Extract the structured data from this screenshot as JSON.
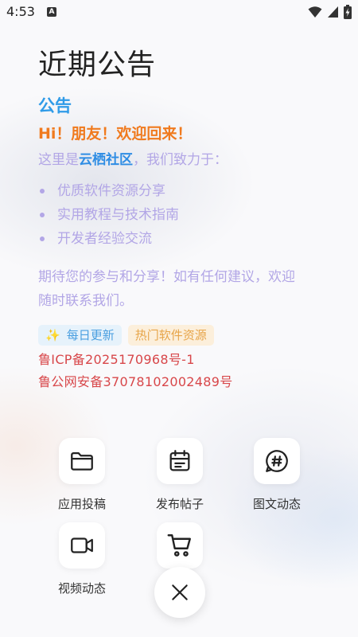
{
  "status_bar": {
    "time": "4:53",
    "notification_icon": "A"
  },
  "title": "近期公告",
  "notice": {
    "heading": "公告",
    "greeting": "Hi！朋友！欢迎回来！",
    "intro_prefix": "这里是",
    "community_name": "云栖社区",
    "intro_suffix": "，我们致力于：",
    "features": [
      "优质软件资源分享",
      "实用教程与技术指南",
      "开发者经验交流"
    ],
    "closing": "期待您的参与和分享！如有任何建议，欢迎随时联系我们。",
    "tags": {
      "daily": "每日更新",
      "hot": "热门软件资源"
    },
    "icp": "鲁ICP备2025170968号-1",
    "police_record": "鲁公网安备37078102002489号"
  },
  "actions": {
    "app_submit": "应用投稿",
    "publish_post": "发布帖子",
    "image_text": "图文动态",
    "video": "视频动态"
  },
  "colors": {
    "accent_blue": "#2f9be8",
    "accent_orange": "#f07a1e",
    "lavender": "#b2a6e6",
    "icp_red": "#d8474a"
  }
}
